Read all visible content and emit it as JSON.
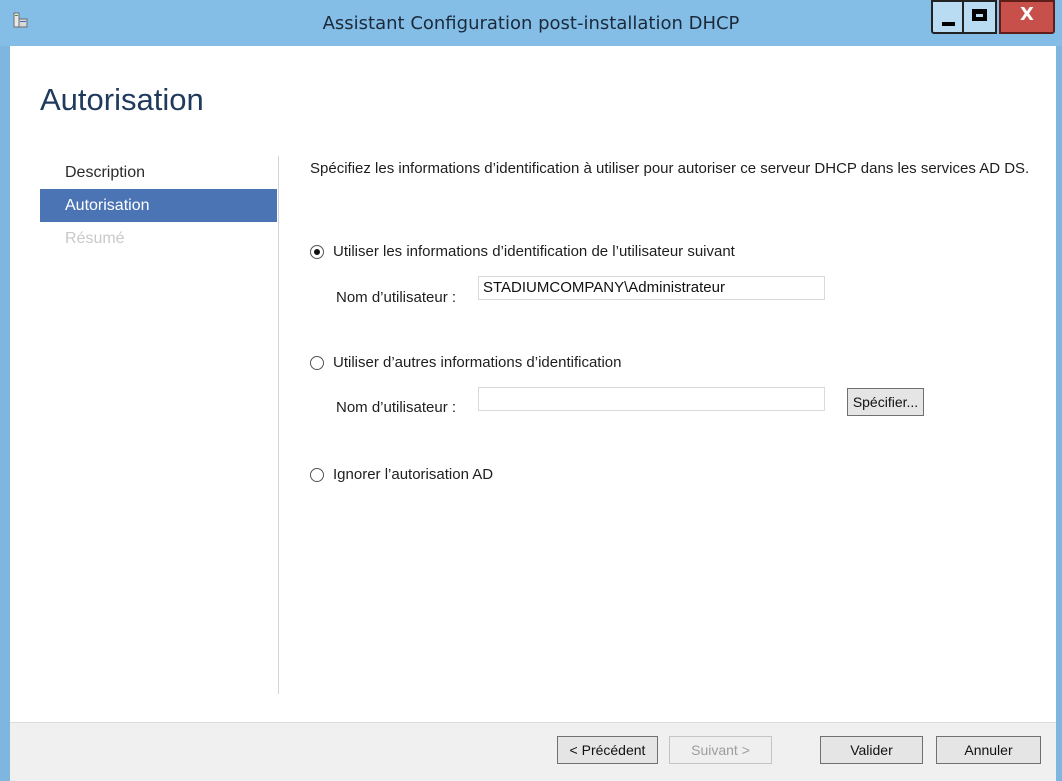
{
  "window": {
    "title": "Assistant Configuration post-installation DHCP",
    "close_glyph": "X",
    "icon": "server-app-icon"
  },
  "page": {
    "title": "Autorisation"
  },
  "nav": {
    "items": [
      {
        "label": "Description",
        "state": "normal"
      },
      {
        "label": "Autorisation",
        "state": "active"
      },
      {
        "label": "Résumé",
        "state": "disabled"
      }
    ]
  },
  "content": {
    "description": "Spécifiez les informations d’identification à utiliser pour autoriser ce serveur DHCP dans les services AD DS.",
    "option_current_user": {
      "label": "Utiliser les informations d’identification de l’utilisateur suivant",
      "checked": true,
      "username_label": "Nom d’utilisateur :",
      "username_value": "STADIUMCOMPANY\\Administrateur"
    },
    "option_other": {
      "label": "Utiliser d’autres informations d’identification",
      "checked": false,
      "username_label": "Nom d’utilisateur :",
      "username_value": "",
      "specify_button": "Spécifier..."
    },
    "option_skip": {
      "label": "Ignorer l’autorisation AD",
      "checked": false
    }
  },
  "footer": {
    "previous": "< Précédent",
    "next": "Suivant >",
    "validate": "Valider",
    "cancel": "Annuler"
  },
  "colors": {
    "titlebar": "#84bee7",
    "nav_active": "#4b74b4",
    "close_button": "#c7504a"
  }
}
